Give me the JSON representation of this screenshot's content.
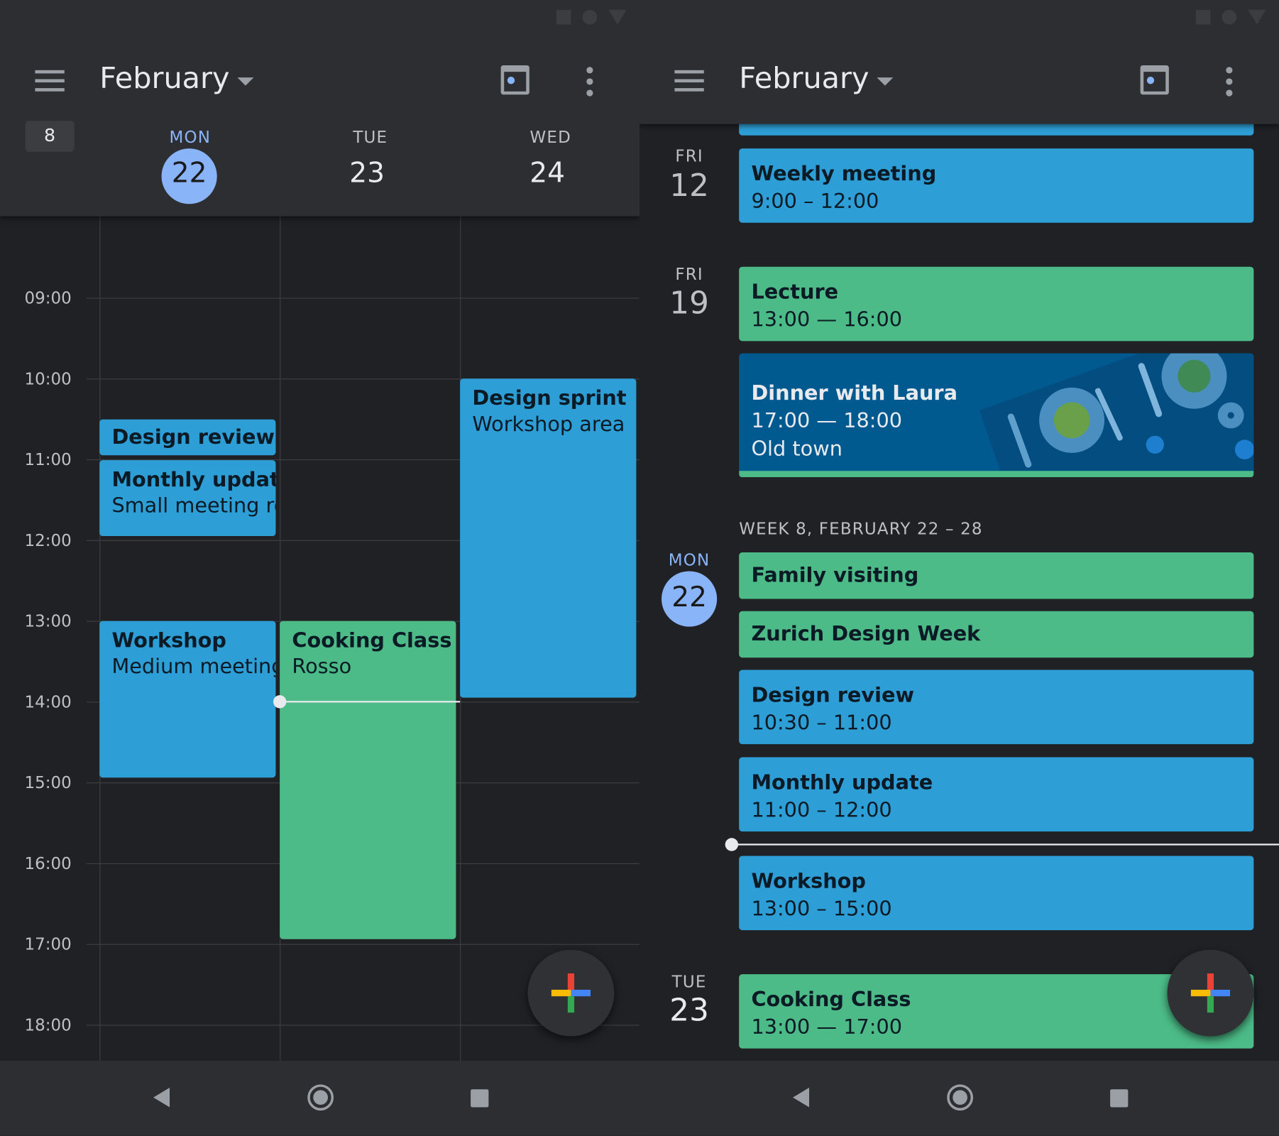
{
  "colors": {
    "event_blue": "#2e9ed6",
    "event_green": "#4cbb87",
    "today_accent": "#8ab4f8",
    "dinner_bg": "#005a8f"
  },
  "left": {
    "title": "February",
    "week_number": "8",
    "days": [
      {
        "dow": "MON",
        "num": "22",
        "today": true
      },
      {
        "dow": "TUE",
        "num": "23"
      },
      {
        "dow": "WED",
        "num": "24"
      }
    ],
    "hours": [
      "09:00",
      "10:00",
      "11:00",
      "12:00",
      "13:00",
      "14:00",
      "15:00",
      "16:00",
      "17:00",
      "18:00"
    ],
    "events": [
      {
        "title": "Design review",
        "sub": "",
        "color": "blue"
      },
      {
        "title": "Monthly update",
        "sub": "Small meeting ro",
        "color": "blue"
      },
      {
        "title": "Workshop",
        "sub": "Medium meeting",
        "color": "blue"
      },
      {
        "title": "Cooking Class",
        "sub": "Rosso",
        "color": "green"
      },
      {
        "title": "Design sprint",
        "sub": "Workshop area",
        "color": "blue"
      }
    ]
  },
  "right": {
    "title": "February",
    "days": [
      {
        "dow": "FRI",
        "num": "12"
      },
      {
        "dow": "FRI",
        "num": "19"
      },
      {
        "dow": "MON",
        "num": "22",
        "today": true
      },
      {
        "dow": "TUE",
        "num": "23"
      }
    ],
    "week_header": "WEEK 8, FEBRUARY 22 – 28",
    "events": [
      {
        "title": "Weekly meeting",
        "time": "9:00 – 12:00",
        "color": "blue"
      },
      {
        "title": "Lecture",
        "time": "13:00 — 16:00",
        "color": "green"
      },
      {
        "title": "Dinner with Laura",
        "time": "17:00 — 18:00",
        "location": "Old town",
        "image": "dinner-table-illustration"
      },
      {
        "title": "Family visiting",
        "color": "green"
      },
      {
        "title": "Zurich Design Week",
        "color": "green"
      },
      {
        "title": "Design review",
        "time": "10:30 – 11:00",
        "color": "blue"
      },
      {
        "title": "Monthly update",
        "time": "11:00 – 12:00",
        "color": "blue"
      },
      {
        "title": "Workshop",
        "time": "13:00 – 15:00",
        "color": "blue"
      },
      {
        "title": "Cooking Class",
        "time": "13:00 — 17:00",
        "color": "green"
      }
    ]
  },
  "icons": {
    "menu": "hamburger-icon",
    "dropdown": "caret-down-icon",
    "today": "calendar-today-icon",
    "more": "more-vert-icon",
    "fab": "plus-icon",
    "nav": [
      "back-icon",
      "home-icon",
      "recents-icon"
    ]
  }
}
